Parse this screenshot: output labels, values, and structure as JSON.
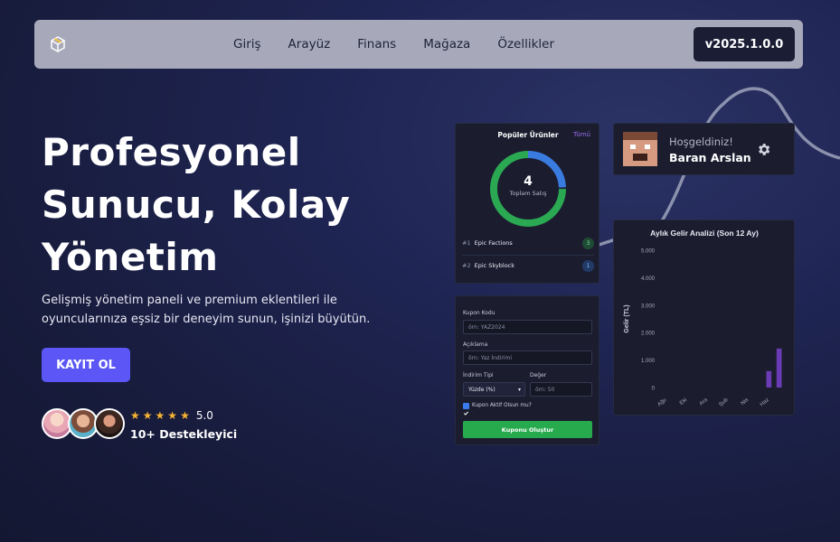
{
  "nav": {
    "links": [
      "Giriş",
      "Arayüz",
      "Finans",
      "Mağaza",
      "Özellikler"
    ],
    "version": "v2025.1.0.0"
  },
  "hero": {
    "title_lines": [
      "Profesyonel",
      "Sunucu, Kolay",
      "Yönetim"
    ],
    "description": "Gelişmiş yönetim paneli ve premium eklentileri ile oyuncularınıza eşsiz bir deneyim sunun, işinizi büyütün.",
    "cta": "KAYIT OL",
    "rating": "5.0",
    "stars": 5,
    "supporters": "10+ Destekleyici"
  },
  "popular": {
    "title": "Popüler Ürünler",
    "all_link": "Tümü",
    "total": "4",
    "total_label": "Toplam Satış",
    "products": [
      {
        "rank": "#1",
        "name": "Epic Factions",
        "count": "3"
      },
      {
        "rank": "#2",
        "name": "Epic Skyblock",
        "count": "1"
      }
    ]
  },
  "welcome": {
    "greeting": "Hoşgeldiniz!",
    "name": "Baran Arslan"
  },
  "coupon": {
    "code_label": "Kupon Kodu",
    "code_placeholder": "örn: YAZ2024",
    "desc_label": "Açıklama",
    "desc_placeholder": "örn: Yaz İndirimi",
    "type_label": "İndirim Tipi",
    "type_value": "Yüzde (%)",
    "value_label": "Değer",
    "value_placeholder": "örn: 50",
    "active_label": "Kupon Aktif Olsun mu?",
    "submit": "Kuponu Oluştur"
  },
  "colors": {
    "accent": "#5b56f5",
    "green": "#27a94e",
    "bar": "#6a3bb5",
    "donut_blue": "#3a7be0",
    "donut_green": "#2aa952"
  },
  "chart_data": {
    "type": "bar",
    "title": "Aylık Gelir Analizi (Son 12 Ay)",
    "ylabel": "Gelir (TL)",
    "xlabel": "",
    "ylim": [
      0,
      5000
    ],
    "yticks": [
      "0",
      "1.000",
      "2.000",
      "3.000",
      "4.000",
      "5.000"
    ],
    "categories": [
      "Ağu",
      "Eki",
      "Ara",
      "Şub",
      "Nis",
      "Haz"
    ],
    "values": [
      0,
      0,
      0,
      0,
      0,
      0,
      0,
      0,
      0,
      0,
      600,
      1420
    ],
    "grid": false
  }
}
